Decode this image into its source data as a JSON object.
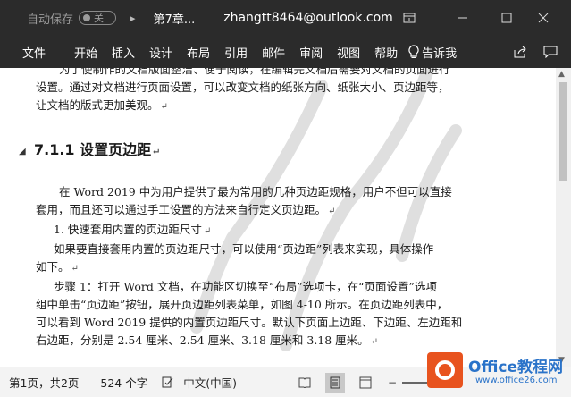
{
  "titlebar": {
    "autosave_label": "自动保存",
    "autosave_state": "关",
    "doc_title": "第7章...",
    "account": "zhangtt8464@outlook.com"
  },
  "ribbon": {
    "tabs": [
      "文件",
      "开始",
      "插入",
      "设计",
      "布局",
      "引用",
      "邮件",
      "审阅",
      "视图",
      "帮助"
    ],
    "tell_me": "告诉我"
  },
  "document": {
    "intro_line1": "为了使制作的文档版面整洁、便于阅读，在编辑完文档后需要对文档的页面进行",
    "intro_line2": "设置。通过对文档进行页面设置，可以改变文档的纸张方向、纸张大小、页边距等，",
    "intro_line3": "让文档的版式更加美观。",
    "heading": "7.1.1  设置页边距",
    "p1_line1": "在 Word  2019 中为用户提供了最为常用的几种页边距规格，用户不但可以直接",
    "p1_line2": "套用，而且还可以通过手工设置的方法来自行定义页边距。",
    "item1": "1. 快速套用内置的页边距尺寸",
    "p2_line1": "如果要直接套用内置的页边距尺寸，可以使用“页边距”列表来实现，具体操作",
    "p2_line2": "如下。",
    "p3_line1": "步骤 1：打开 Word 文档，在功能区切换至“布局”选项卡，在“页面设置”选项",
    "p3_line2": "组中单击“页边距”按钮，展开页边距列表菜单，如图 4-10 所示。在页边距列表中，",
    "p3_line3": "可以看到 Word 2019 提供的内置页边距尺寸。默认下页面上边距、下边距、左边距和",
    "p3_line4": "右边距，分别是 2.54 厘米、2.54 厘米、3.18 厘米和 3.18 厘米。"
  },
  "statusbar": {
    "page": "第1页，共2页",
    "words": "524 个字",
    "language": "中文(中国)"
  },
  "logo": {
    "name": "Office教程网",
    "url": "www.office26.com"
  },
  "colors": {
    "titlebar_bg": "#2b2b2b",
    "logo_orange": "#e8531e",
    "logo_blue": "#2a73c9"
  }
}
